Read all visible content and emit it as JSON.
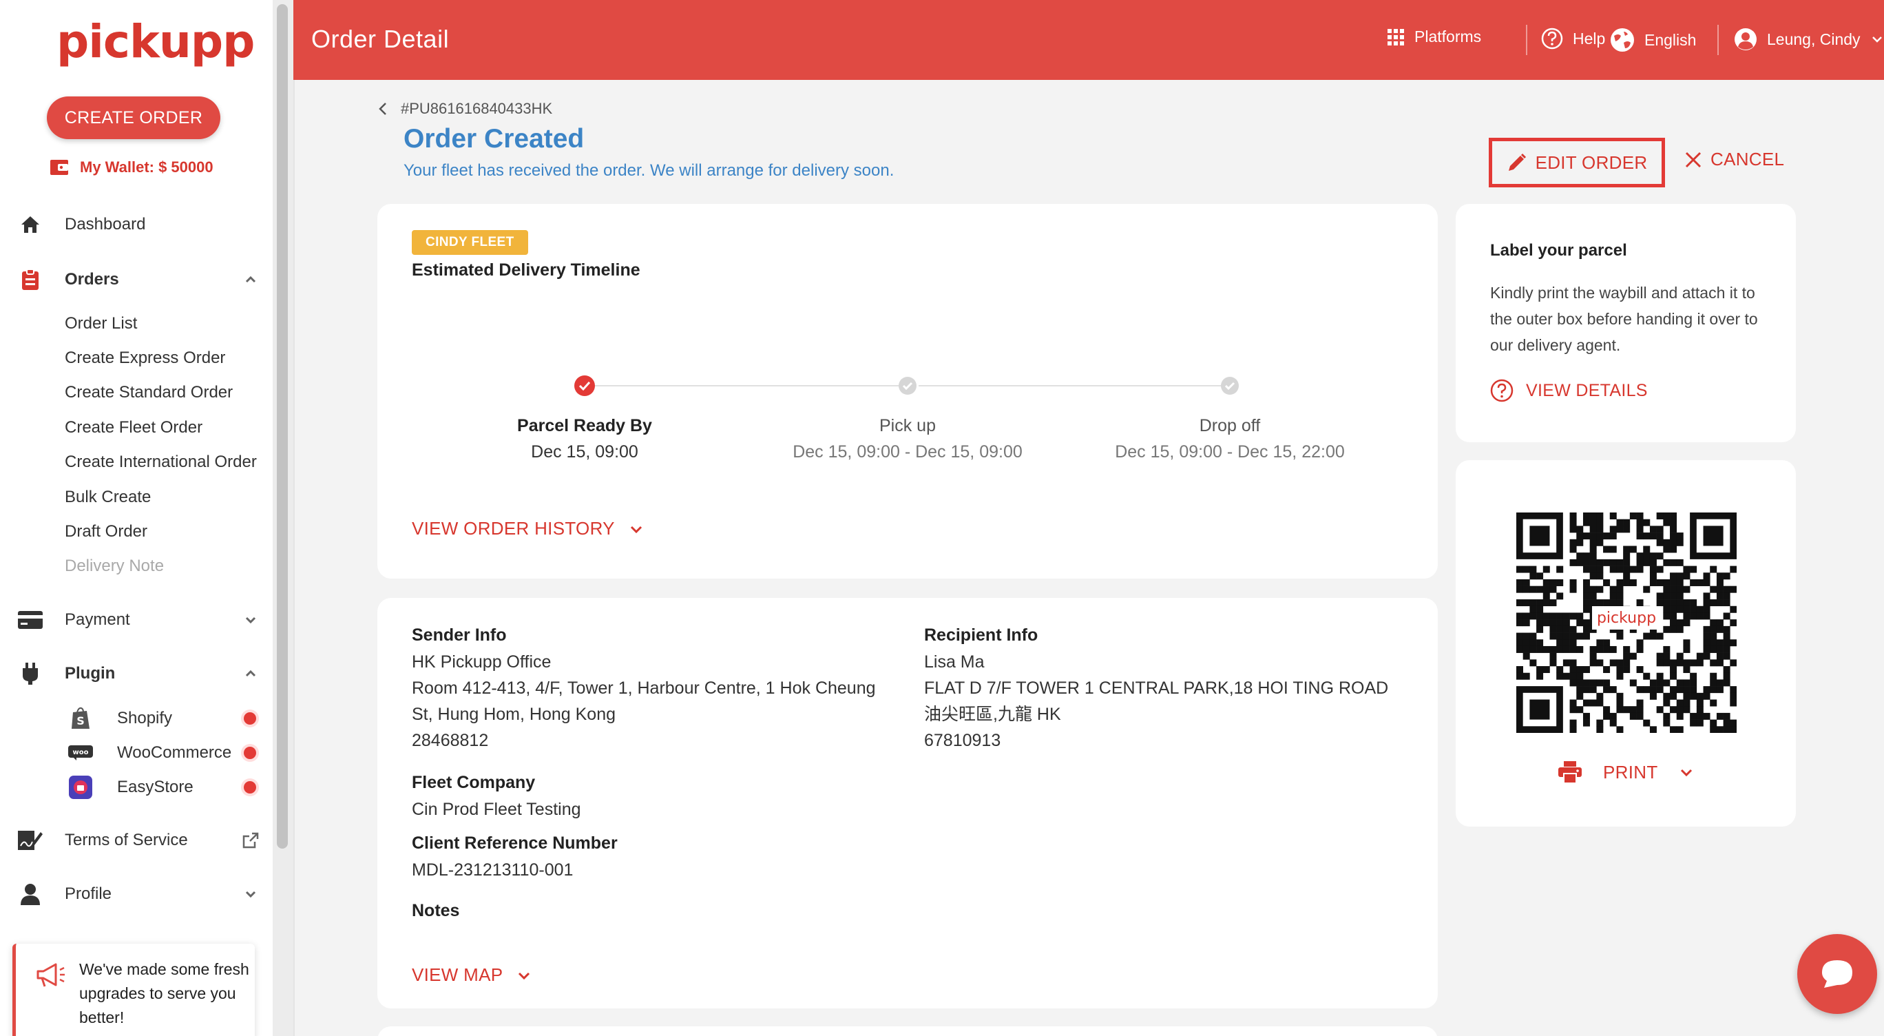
{
  "brand": {
    "logo_text": "pickupp",
    "accent": "#e04a43",
    "link_blue": "#3c84c6",
    "badge_color": "#f1b43b"
  },
  "sidebar": {
    "create_order_label": "CREATE ORDER",
    "wallet_label": "My Wallet: $ 50000",
    "items": {
      "dashboard": "Dashboard",
      "orders": "Orders",
      "payment": "Payment",
      "plugin": "Plugin",
      "terms": "Terms of Service",
      "profile": "Profile"
    },
    "orders_sub": [
      "Order List",
      "Create Express Order",
      "Create Standard Order",
      "Create Fleet Order",
      "Create International Order",
      "Bulk Create",
      "Draft Order",
      "Delivery Note"
    ],
    "plugins": [
      "Shopify",
      "WooCommerce",
      "EasyStore"
    ],
    "promo_text": "We've made some fresh upgrades to serve you better!"
  },
  "header": {
    "title": "Order Detail",
    "platforms": "Platforms",
    "help": "Help",
    "language": "English",
    "user": "Leung, Cindy"
  },
  "order": {
    "id": "#PU861616840433HK",
    "status": "Order Created",
    "status_message": "Your fleet has received the order. We will arrange for delivery soon.",
    "edit_label": "EDIT ORDER",
    "cancel_label": "CANCEL"
  },
  "timeline": {
    "badge": "CINDY FLEET",
    "title": "Estimated Delivery Timeline",
    "steps": [
      {
        "name": "Parcel Ready By",
        "time": "Dec 15, 09:00",
        "state": "done"
      },
      {
        "name": "Pick up",
        "time": "Dec 15, 09:00 - Dec 15, 09:00",
        "state": "pending"
      },
      {
        "name": "Drop off",
        "time": "Dec 15, 09:00 - Dec 15, 22:00",
        "state": "pending"
      }
    ],
    "history_link": "VIEW ORDER HISTORY"
  },
  "info": {
    "sender_title": "Sender Info",
    "sender_name": "HK Pickupp Office",
    "sender_address_1": "Room 412-413, 4/F, Tower 1, Harbour Centre, 1 Hok Cheung",
    "sender_address_2": "St, Hung Hom, Hong Kong",
    "sender_phone": "28468812",
    "recipient_title": "Recipient Info",
    "recipient_name": "Lisa Ma",
    "recipient_address_1": "FLAT D 7/F TOWER 1 CENTRAL PARK,18 HOI TING ROAD",
    "recipient_address_2": "油尖旺區,九龍 HK",
    "recipient_phone": "67810913",
    "fleet_title": "Fleet Company",
    "fleet_value": "Cin Prod Fleet Testing",
    "ref_title": "Client Reference Number",
    "ref_value": "MDL-231213110-001",
    "notes_title": "Notes",
    "map_link": "VIEW MAP"
  },
  "label_card": {
    "title": "Label your parcel",
    "text": "Kindly print the waybill and attach it to the outer box before handing it over to our delivery agent.",
    "link": "VIEW DETAILS"
  },
  "qr_card": {
    "logo_text": "pickupp",
    "print_label": "PRINT"
  },
  "icons": [
    "home-icon",
    "clipboard-icon",
    "card-icon",
    "plug-icon",
    "shopify-icon",
    "woo-icon",
    "easystore-icon",
    "sign-icon",
    "user-icon",
    "external-link-icon",
    "grid-icon",
    "help-icon",
    "globe-icon",
    "avatar-icon",
    "pencil-icon",
    "close-icon",
    "check-icon",
    "chevron-down-icon",
    "printer-icon",
    "megaphone-icon",
    "chat-icon"
  ]
}
